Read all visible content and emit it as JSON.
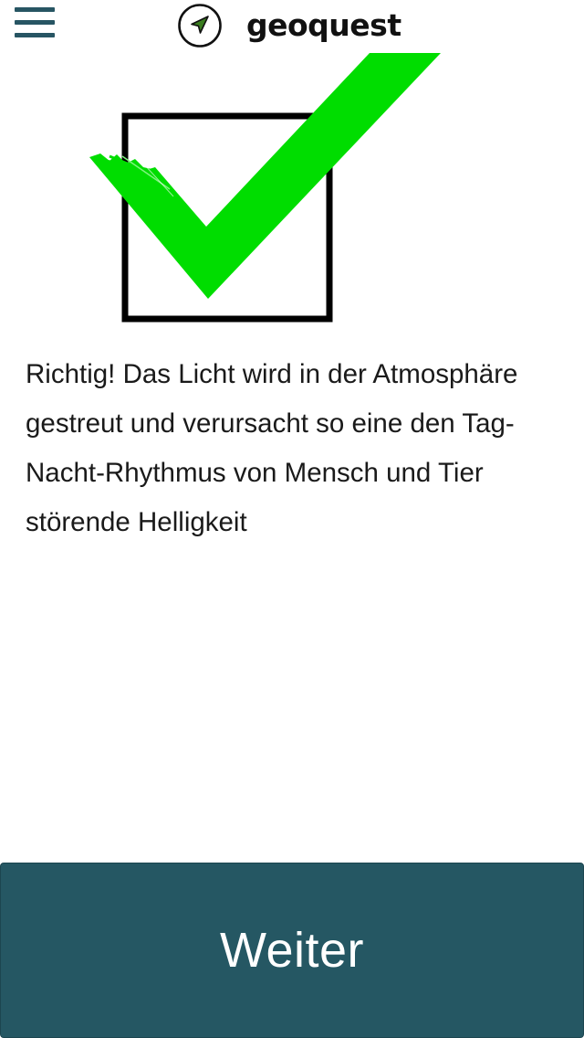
{
  "header": {
    "menu_icon": "hamburger-menu-icon",
    "logo_icon": "navigation-arrow-icon",
    "brand_name": "geoquest"
  },
  "result": {
    "icon": "checkmark-in-box-icon",
    "message": "Richtig! Das Licht wird in der Atmosphäre gestreut und verursacht so eine den Tag-Nacht-Rhythmus von Mensch und Tier störende Helligkeit"
  },
  "footer": {
    "next_label": "Weiter"
  },
  "colors": {
    "primary": "#255763",
    "check_green": "#00dd00",
    "text": "#1a1a1a"
  }
}
